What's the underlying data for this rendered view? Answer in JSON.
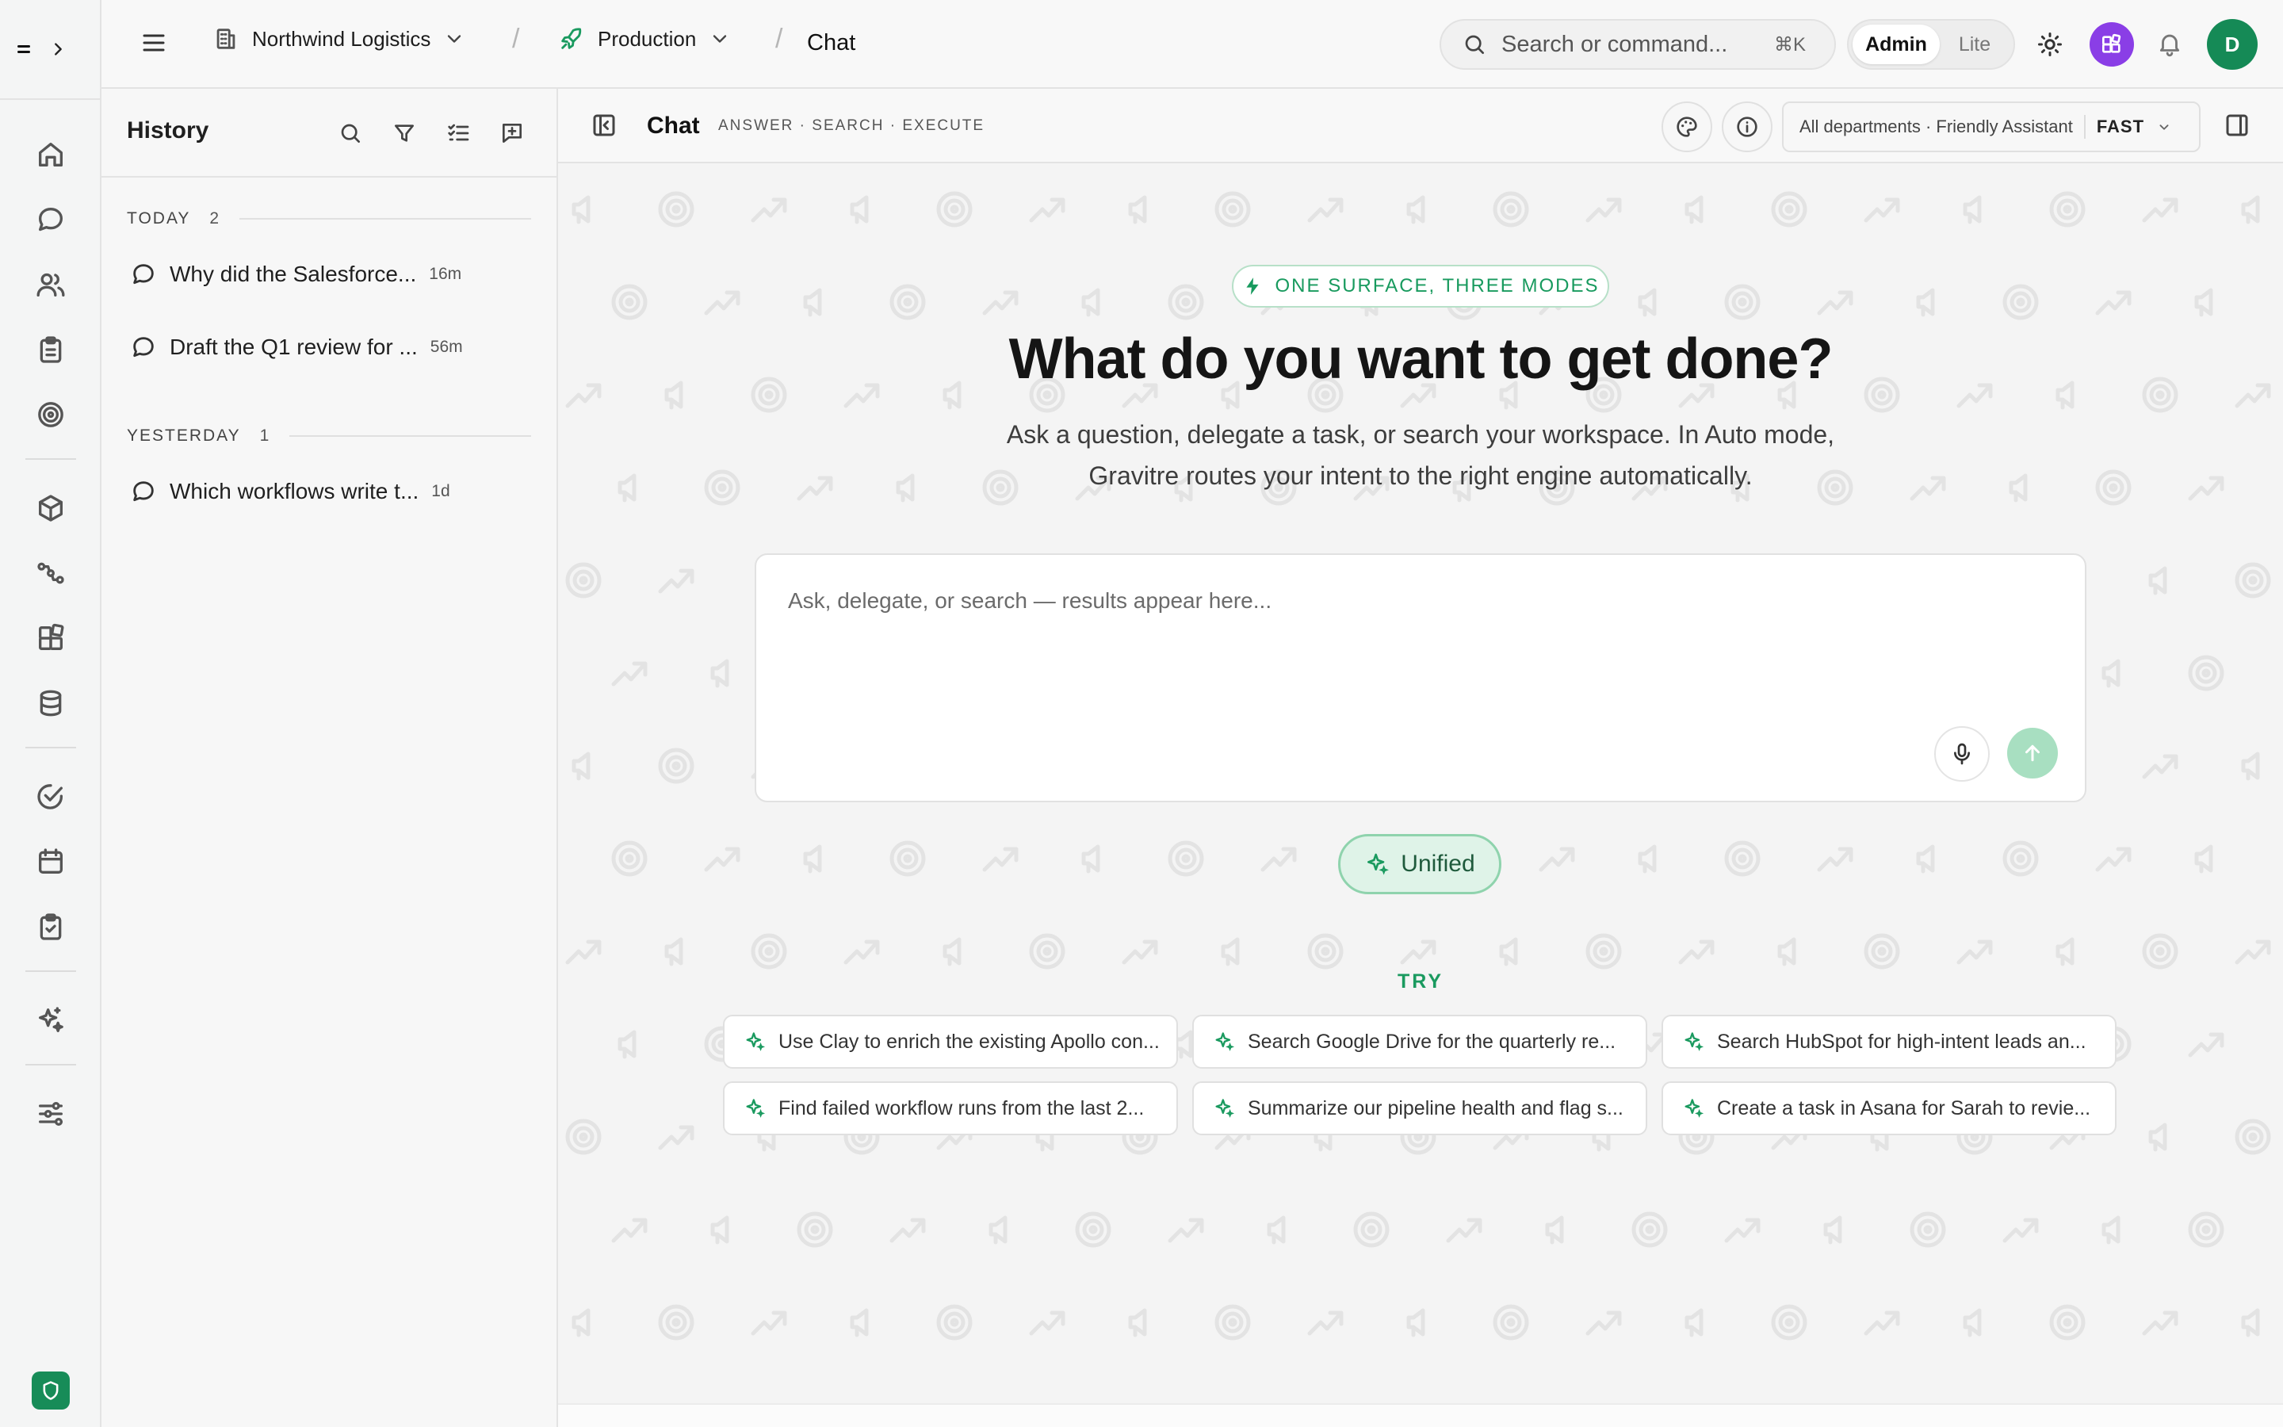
{
  "topbar": {
    "org": "Northwind Logistics",
    "env": "Production",
    "page": "Chat",
    "search_placeholder": "Search or command...",
    "shortcut": "⌘K",
    "modes": [
      "Admin",
      "Lite"
    ],
    "avatar_initial": "D"
  },
  "rail": {
    "items": [
      "home-icon",
      "chat-icon",
      "users-icon",
      "clipboard-icon",
      "target-icon",
      "cube-icon",
      "workflow-icon",
      "apps-icon",
      "database-icon",
      "check-circle-icon",
      "calendar-icon",
      "clipboard-check-icon",
      "sparkles-icon",
      "sliders-icon"
    ]
  },
  "history": {
    "title": "History",
    "groups": [
      {
        "label": "TODAY",
        "count": "2"
      },
      {
        "label": "YESTERDAY",
        "count": "1"
      }
    ],
    "items": [
      {
        "title": "Why did the Salesforce...",
        "ago": "16m"
      },
      {
        "title": "Draft the Q1 review for ...",
        "ago": "56m"
      },
      {
        "title": "Which workflows write t...",
        "ago": "1d"
      }
    ]
  },
  "main": {
    "title": "Chat",
    "subtitle": "ANSWER · SEARCH · EXECUTE",
    "scope": "All departments · Friendly Assistant",
    "speed": "FAST",
    "badge": "ONE SURFACE, THREE MODES",
    "hero_title": "What do you want to get done?",
    "hero_sub": "Ask a question, delegate a task, or search your workspace. In Auto mode, Gravitre routes your intent to the right engine automatically.",
    "composer_placeholder": "Ask, delegate, or search — results appear here...",
    "mode_pill": "Unified",
    "try_label": "TRY",
    "suggestions": [
      "Use Clay to enrich the existing Apollo con...",
      "Search Google Drive for the quarterly re...",
      "Search HubSpot for high-intent leads an...",
      "Find failed workflow runs from the last 2...",
      "Summarize our pipeline health and flag s...",
      "Create a task in Asana for Sarah to revie..."
    ]
  },
  "colors": {
    "accent_green": "#189a5e",
    "avatar_green": "#158a56",
    "apps_purple": "#8a3ee6"
  }
}
